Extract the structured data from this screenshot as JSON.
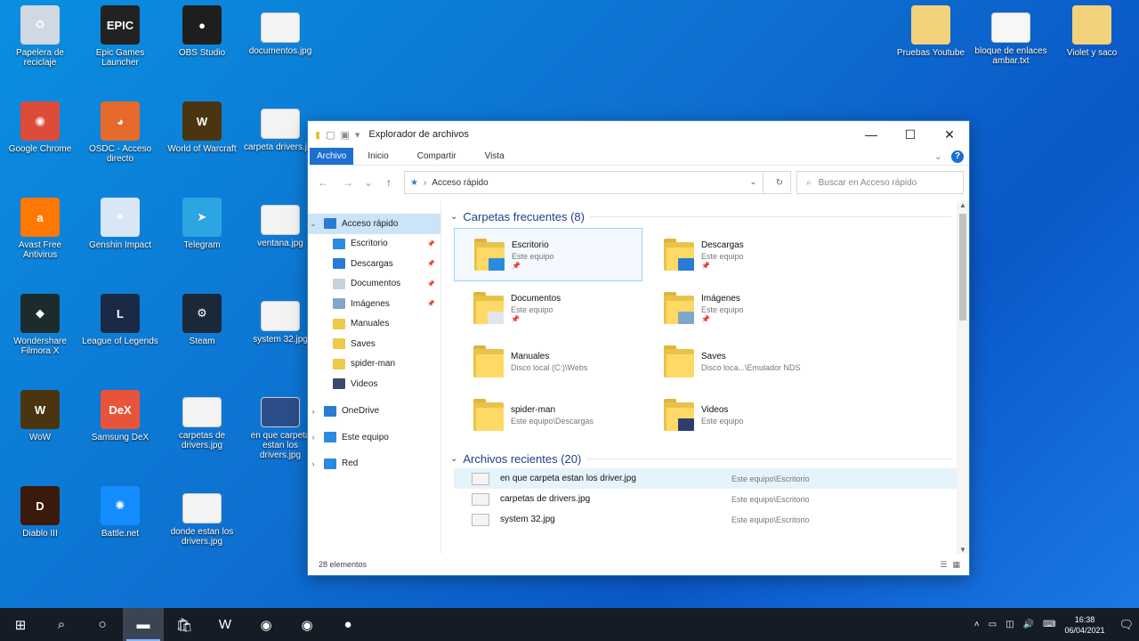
{
  "desktop_icons": [
    {
      "label": "Papelera de reciclaje",
      "icon": "recycle-bin-icon",
      "color": "#cfd8e3",
      "glyph": "♻"
    },
    {
      "label": "Epic Games Launcher",
      "icon": "epic-games-icon",
      "color": "#222222",
      "glyph": "EPIC"
    },
    {
      "label": "OBS Studio",
      "icon": "obs-icon",
      "color": "#1e1e1e",
      "glyph": "●"
    },
    {
      "label": "documentos.jpg",
      "icon": "image-file-icon",
      "color": "#f3f3f3",
      "glyph": ""
    },
    {
      "label": "Google Chrome",
      "icon": "chrome-icon",
      "color": "#dd4b39",
      "glyph": "◉"
    },
    {
      "label": "OSDC - Acceso directo",
      "icon": "osdc-icon",
      "color": "#e66a2c",
      "glyph": "◕"
    },
    {
      "label": "World of Warcraft",
      "icon": "wow-icon",
      "color": "#4a3510",
      "glyph": "W"
    },
    {
      "label": "carpeta drivers.jpg",
      "icon": "image-file-icon",
      "color": "#f3f3f3",
      "glyph": ""
    },
    {
      "label": "Avast Free Antivirus",
      "icon": "avast-icon",
      "color": "#ff7800",
      "glyph": "a"
    },
    {
      "label": "Genshin Impact",
      "icon": "genshin-icon",
      "color": "#d9e6f5",
      "glyph": "✦"
    },
    {
      "label": "Telegram",
      "icon": "telegram-icon",
      "color": "#2ca5e0",
      "glyph": "➤"
    },
    {
      "label": "ventana.jpg",
      "icon": "image-file-icon",
      "color": "#f3f3f3",
      "glyph": ""
    },
    {
      "label": "Wondershare Filmora X",
      "icon": "filmora-icon",
      "color": "#1c2b2b",
      "glyph": "◆"
    },
    {
      "label": "League of Legends",
      "icon": "lol-icon",
      "color": "#1a2a44",
      "glyph": "L"
    },
    {
      "label": "Steam",
      "icon": "steam-icon",
      "color": "#1b2838",
      "glyph": "⚙"
    },
    {
      "label": "system 32.jpg",
      "icon": "image-file-icon",
      "color": "#f3f3f3",
      "glyph": ""
    },
    {
      "label": "WoW",
      "icon": "wow-icon",
      "color": "#4a3510",
      "glyph": "W"
    },
    {
      "label": "Samsung DeX",
      "icon": "samsung-dex-icon",
      "color": "#e8543a",
      "glyph": "DeX"
    },
    {
      "label": "carpetas de drivers.jpg",
      "icon": "image-file-icon",
      "color": "#f3f3f3",
      "glyph": ""
    },
    {
      "label": "en que carpeta estan los drivers.jpg",
      "icon": "image-file-icon",
      "color": "#2b4e8a",
      "glyph": ""
    },
    {
      "label": "Diablo III",
      "icon": "diablo-icon",
      "color": "#3a1a0a",
      "glyph": "D"
    },
    {
      "label": "Battle.net",
      "icon": "battlenet-icon",
      "color": "#148eff",
      "glyph": "✺"
    },
    {
      "label": "donde estan los drivers.jpg",
      "icon": "image-file-icon",
      "color": "#f3f3f3",
      "glyph": ""
    },
    {
      "label": "Pruebas Youtube",
      "icon": "folder-icon",
      "color": "#f2d27a",
      "glyph": ""
    },
    {
      "label": "bloque de enlaces ambar.txt",
      "icon": "text-file-icon",
      "color": "#f7f7f7",
      "glyph": ""
    },
    {
      "label": "Violet y saco",
      "icon": "folder-icon",
      "color": "#f2d27a",
      "glyph": ""
    }
  ],
  "window": {
    "title": "Explorador de archivos",
    "ribbon_tabs": [
      "Archivo",
      "Inicio",
      "Compartir",
      "Vista"
    ],
    "address": "Acceso rápido",
    "search_placeholder": "Buscar en Acceso rápido",
    "nav": [
      {
        "label": "Acceso rápido",
        "icon": "star-icon",
        "color": "#2a7bd5",
        "pin": false,
        "tree": "⌄",
        "sel": true
      },
      {
        "label": "Escritorio",
        "icon": "desktop-icon",
        "color": "#2a8be0",
        "pin": true,
        "tree": "",
        "sel": false
      },
      {
        "label": "Descargas",
        "icon": "download-icon",
        "color": "#2a7bd5",
        "pin": true,
        "tree": "",
        "sel": false
      },
      {
        "label": "Documentos",
        "icon": "documents-icon",
        "color": "#c8d0da",
        "pin": true,
        "tree": "",
        "sel": false
      },
      {
        "label": "Imágenes",
        "icon": "pictures-icon",
        "color": "#7fa7c9",
        "pin": true,
        "tree": "",
        "sel": false
      },
      {
        "label": "Manuales",
        "icon": "folder-icon",
        "color": "#f0c84a",
        "pin": false,
        "tree": "",
        "sel": false
      },
      {
        "label": "Saves",
        "icon": "folder-icon",
        "color": "#f0c84a",
        "pin": false,
        "tree": "",
        "sel": false
      },
      {
        "label": "spider-man",
        "icon": "folder-icon",
        "color": "#f0c84a",
        "pin": false,
        "tree": "",
        "sel": false
      },
      {
        "label": "Videos",
        "icon": "videos-icon",
        "color": "#3b4a6b",
        "pin": false,
        "tree": "",
        "sel": false
      }
    ],
    "nav_roots": [
      {
        "label": "OneDrive",
        "icon": "onedrive-icon",
        "color": "#2a7bd5"
      },
      {
        "label": "Este equipo",
        "icon": "computer-icon",
        "color": "#2a8be0"
      },
      {
        "label": "Red",
        "icon": "network-icon",
        "color": "#2a8be0"
      }
    ],
    "frequent_header": "Carpetas frecuentes (8)",
    "frequent": [
      {
        "name": "Escritorio",
        "loc": "Este equipo",
        "pinned": true,
        "badge": "#2a8be0",
        "sel": true
      },
      {
        "name": "Descargas",
        "loc": "Este equipo",
        "pinned": true,
        "badge": "#2a7bd5",
        "sel": false
      },
      {
        "name": "Documentos",
        "loc": "Este equipo",
        "pinned": true,
        "badge": "#dfe6ee",
        "sel": false
      },
      {
        "name": "Imágenes",
        "loc": "Este equipo",
        "pinned": true,
        "badge": "#7fa7c9",
        "sel": false
      },
      {
        "name": "Manuales",
        "loc": "Disco local (C:)\\Webs",
        "pinned": false,
        "badge": "",
        "sel": false
      },
      {
        "name": "Saves",
        "loc": "Disco loca...\\Emulador NDS",
        "pinned": false,
        "badge": "",
        "sel": false
      },
      {
        "name": "spider-man",
        "loc": "Este equipo\\Descargas",
        "pinned": false,
        "badge": "",
        "sel": false
      },
      {
        "name": "Videos",
        "loc": "Este equipo",
        "pinned": false,
        "badge": "#2b3f6e",
        "sel": false
      }
    ],
    "recent_header": "Archivos recientes (20)",
    "recent": [
      {
        "name": "en que carpeta estan los driver.jpg",
        "path": "Este equipo\\Escritorio",
        "hl": true
      },
      {
        "name": "carpetas de drivers.jpg",
        "path": "Este equipo\\Escritorio",
        "hl": false
      },
      {
        "name": "system 32.jpg",
        "path": "Este equipo\\Escritorio",
        "hl": false
      }
    ],
    "status": "28 elementos"
  },
  "taskbar": {
    "items": [
      {
        "name": "start-button",
        "glyph": "⊞",
        "active": false
      },
      {
        "name": "search-icon",
        "glyph": "⌕",
        "active": false
      },
      {
        "name": "cortana-icon",
        "glyph": "○",
        "active": false
      },
      {
        "name": "file-explorer-icon",
        "glyph": "▬",
        "active": true
      },
      {
        "name": "store-icon",
        "glyph": "🛍",
        "active": false
      },
      {
        "name": "world-of-warcraft-icon",
        "glyph": "W",
        "active": false
      },
      {
        "name": "chrome-icon",
        "glyph": "◉",
        "active": false
      },
      {
        "name": "chrome-icon",
        "glyph": "◉",
        "active": false
      },
      {
        "name": "obs-icon",
        "glyph": "●",
        "active": false
      }
    ],
    "time": "16:38",
    "date": "06/04/2021"
  }
}
